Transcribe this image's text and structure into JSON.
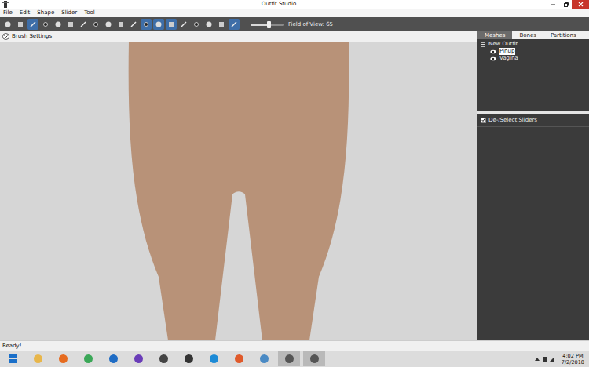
{
  "window": {
    "title": "Outfit Studio"
  },
  "menu": [
    "File",
    "Edit",
    "Shape",
    "Slider",
    "Tool"
  ],
  "toolbar": {
    "tools": [
      {
        "selected": false
      },
      {
        "selected": false
      },
      {
        "selected": true
      },
      {
        "selected": false
      },
      {
        "selected": false
      },
      {
        "selected": false
      },
      {
        "selected": false
      },
      {
        "selected": false
      },
      {
        "selected": false
      },
      {
        "selected": false
      },
      {
        "selected": false
      },
      {
        "selected": true
      },
      {
        "selected": true
      },
      {
        "selected": true
      },
      {
        "selected": false
      },
      {
        "selected": false
      },
      {
        "selected": false
      },
      {
        "selected": false
      },
      {
        "selected": true
      }
    ],
    "fov": {
      "label": "Field of View: 65",
      "level": 0.55
    }
  },
  "brush_settings": {
    "label": "Brush Settings",
    "expanded": false
  },
  "panel": {
    "tabs": [
      {
        "label": "Meshes",
        "selected": true
      },
      {
        "label": "Bones",
        "selected": false
      },
      {
        "label": "Partitions",
        "selected": false
      }
    ],
    "tree": {
      "label": "New Outfit",
      "expanded": true,
      "children": [
        {
          "label": "Pinup",
          "visible": true,
          "selected": true
        },
        {
          "label": "Vagina",
          "visible": true,
          "selected": false
        }
      ]
    },
    "sliders_toggle": {
      "label": "De-/Select Sliders",
      "checked": true
    }
  },
  "status_bar": "Ready!",
  "taskbar": {
    "time": "4:02 PM",
    "date": "7/2/2018",
    "apps": [
      {
        "active": false
      },
      {
        "active": false
      },
      {
        "active": false
      },
      {
        "active": false
      },
      {
        "active": false
      },
      {
        "active": false
      },
      {
        "active": false
      },
      {
        "active": false
      },
      {
        "active": false
      },
      {
        "active": false
      },
      {
        "active": false
      },
      {
        "active": true
      },
      {
        "active": true
      }
    ]
  }
}
